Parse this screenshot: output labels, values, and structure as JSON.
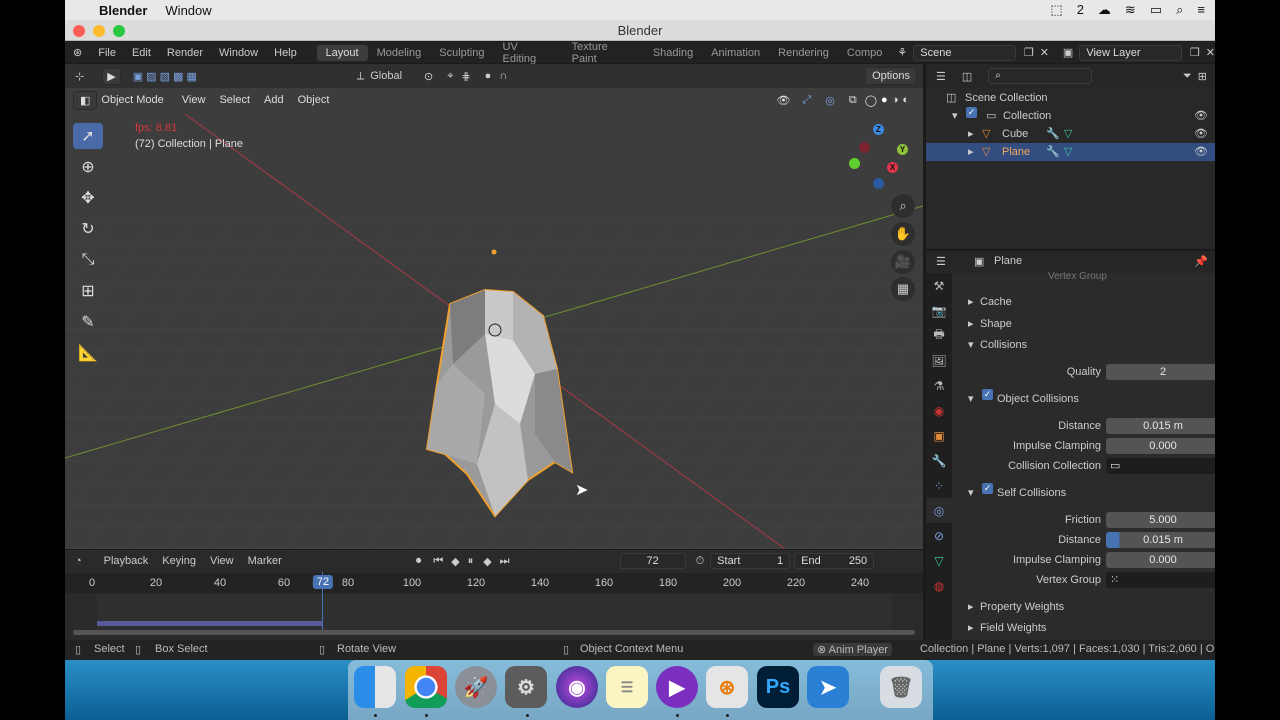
{
  "menubar": {
    "app": "Blender",
    "window": "Window",
    "badge": "2"
  },
  "titlebar": {
    "title": "Blender"
  },
  "topbar": {
    "menus": [
      "File",
      "Edit",
      "Render",
      "Window",
      "Help"
    ],
    "workspaces": [
      "Layout",
      "Modeling",
      "Sculpting",
      "UV Editing",
      "Texture Paint",
      "Shading",
      "Animation",
      "Rendering",
      "Compo"
    ],
    "scene": "Scene",
    "view_layer": "View Layer"
  },
  "viewport": {
    "orientation": "Global",
    "options": "Options",
    "mode": "Object Mode",
    "menus": [
      "View",
      "Select",
      "Add",
      "Object"
    ],
    "fps": "fps: 8.81",
    "info": "(72) Collection | Plane",
    "gizmo": {
      "x": "X",
      "y": "Y",
      "z": "Z"
    }
  },
  "outliner": {
    "scene_collection": "Scene Collection",
    "collection": "Collection",
    "items": [
      "Cube",
      "Plane"
    ]
  },
  "properties": {
    "object": "Plane",
    "vertex_group_cut": "Vertex Group",
    "panels": {
      "cache": "Cache",
      "shape": "Shape",
      "collisions": "Collisions",
      "object_collisions": "Object Collisions",
      "self_collisions": "Self Collisions",
      "property_weights": "Property Weights",
      "field_weights": "Field Weights"
    },
    "quality": {
      "label": "Quality",
      "value": "2"
    },
    "obj_distance": {
      "label": "Distance",
      "value": "0.015 m"
    },
    "obj_impulse": {
      "label": "Impulse Clamping",
      "value": "0.000"
    },
    "collision_collection": {
      "label": "Collision Collection"
    },
    "friction": {
      "label": "Friction",
      "value": "5.000"
    },
    "self_distance": {
      "label": "Distance",
      "value": "0.015 m"
    },
    "self_impulse": {
      "label": "Impulse Clamping",
      "value": "0.000"
    },
    "vertex_group": {
      "label": "Vertex Group"
    }
  },
  "timeline": {
    "menus": [
      "Playback",
      "Keying",
      "View",
      "Marker"
    ],
    "current_frame": "72",
    "start_label": "Start",
    "start": "1",
    "end_label": "End",
    "end": "250",
    "ticks": [
      "0",
      "20",
      "40",
      "60",
      "80",
      "100",
      "120",
      "140",
      "160",
      "180",
      "200",
      "220",
      "240"
    ]
  },
  "statusbar": {
    "select": "Select",
    "box_select": "Box Select",
    "rotate": "Rotate View",
    "context": "Object Context Menu",
    "anim": "Anim Player",
    "stats": "Collection | Plane | Verts:1,097 | Faces:1,030 | Tris:2,060 | Ob"
  },
  "dock": {
    "photoshop": "Ps"
  }
}
